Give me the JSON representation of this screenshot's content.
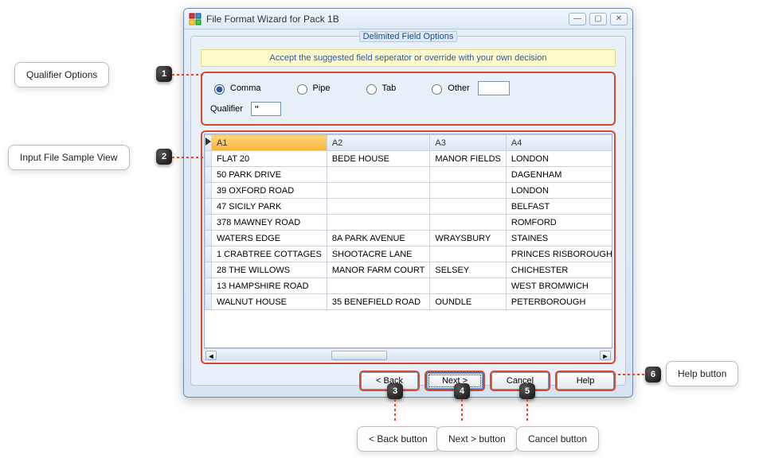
{
  "window": {
    "title": "File Format Wizard for Pack 1B"
  },
  "group": {
    "title": "Delimited Field Options",
    "hint": "Accept the suggested field seperator or override with your own decision"
  },
  "separator_options": {
    "comma": "Comma",
    "pipe": "Pipe",
    "tab": "Tab",
    "other": "Other",
    "qualifier_label": "Qualifier",
    "qualifier_value": "\""
  },
  "table": {
    "headers": [
      "A1",
      "A2",
      "A3",
      "A4"
    ],
    "rows": [
      [
        "FLAT 20",
        "BEDE HOUSE",
        "MANOR FIELDS",
        "LONDON"
      ],
      [
        "50 PARK DRIVE",
        "",
        "",
        "DAGENHAM"
      ],
      [
        "39 OXFORD ROAD",
        "",
        "",
        "LONDON"
      ],
      [
        "47 SICILY PARK",
        "",
        "",
        "BELFAST"
      ],
      [
        "378 MAWNEY ROAD",
        "",
        "",
        "ROMFORD"
      ],
      [
        "WATERS EDGE",
        "8A PARK AVENUE",
        "WRAYSBURY",
        "STAINES"
      ],
      [
        "1 CRABTREE COTTAGES",
        "SHOOTACRE LANE",
        "",
        "PRINCES RISBOROUGH"
      ],
      [
        "28 THE WILLOWS",
        "MANOR FARM COURT",
        "SELSEY",
        "CHICHESTER"
      ],
      [
        "13 HAMPSHIRE ROAD",
        "",
        "",
        "WEST BROMWICH"
      ],
      [
        "WALNUT HOUSE",
        "35 BENEFIELD ROAD",
        "OUNDLE",
        "PETERBOROUGH"
      ]
    ]
  },
  "buttons": {
    "back": "< Back",
    "next": "Next >",
    "cancel": "Cancel",
    "help": "Help"
  },
  "callouts": {
    "c1": "Qualifier Options",
    "c2": "Input File Sample View",
    "c3": "< Back button",
    "c4": "Next > button",
    "c5": "Cancel button",
    "c6": "Help button"
  }
}
